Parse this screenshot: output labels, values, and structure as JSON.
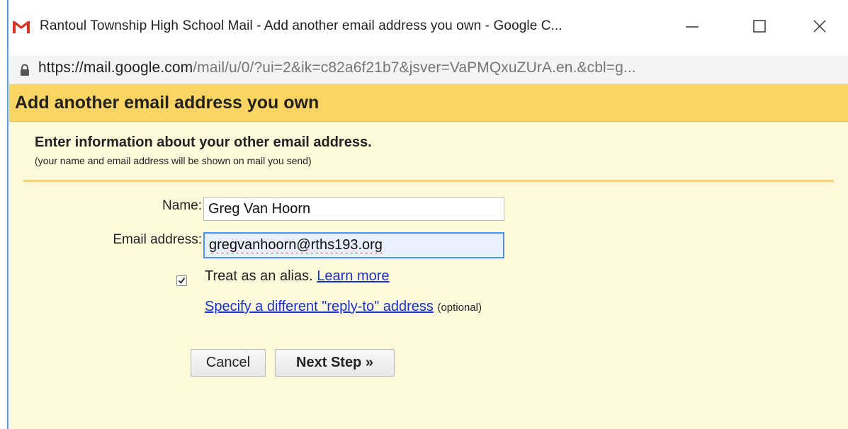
{
  "window": {
    "title": "Rantoul Township High School Mail - Add another email address you own - Google C...",
    "controls": {
      "minimize": "minimize-icon",
      "maximize": "maximize-icon",
      "close": "close-icon"
    }
  },
  "address_bar": {
    "icon": "lock-icon",
    "url_host": "https://mail.google.com",
    "url_path": "/mail/u/0/?ui=2&ik=c82a6f21b7&jsver=VaPMQxuZUrA.en.&cbl=g..."
  },
  "dialog": {
    "title": "Add another email address you own",
    "heading": "Enter information about your other email address.",
    "subheading": "(your name and email address will be shown on mail you send)",
    "name_label": "Name:",
    "name_value": "Greg Van Hoorn",
    "email_label": "Email address:",
    "email_value": "gregvanhoorn@rths193.org",
    "alias_checked": true,
    "alias_text": "Treat as an alias.",
    "learn_more": "Learn more",
    "replyto_link": "Specify a different \"reply-to\" address",
    "optional": "(optional)",
    "cancel": "Cancel",
    "next": "Next Step »"
  },
  "colors": {
    "header_bg": "#fbd563",
    "body_bg": "#fff9dc",
    "link": "#1a31c8",
    "focus_border": "#4d90fe"
  }
}
